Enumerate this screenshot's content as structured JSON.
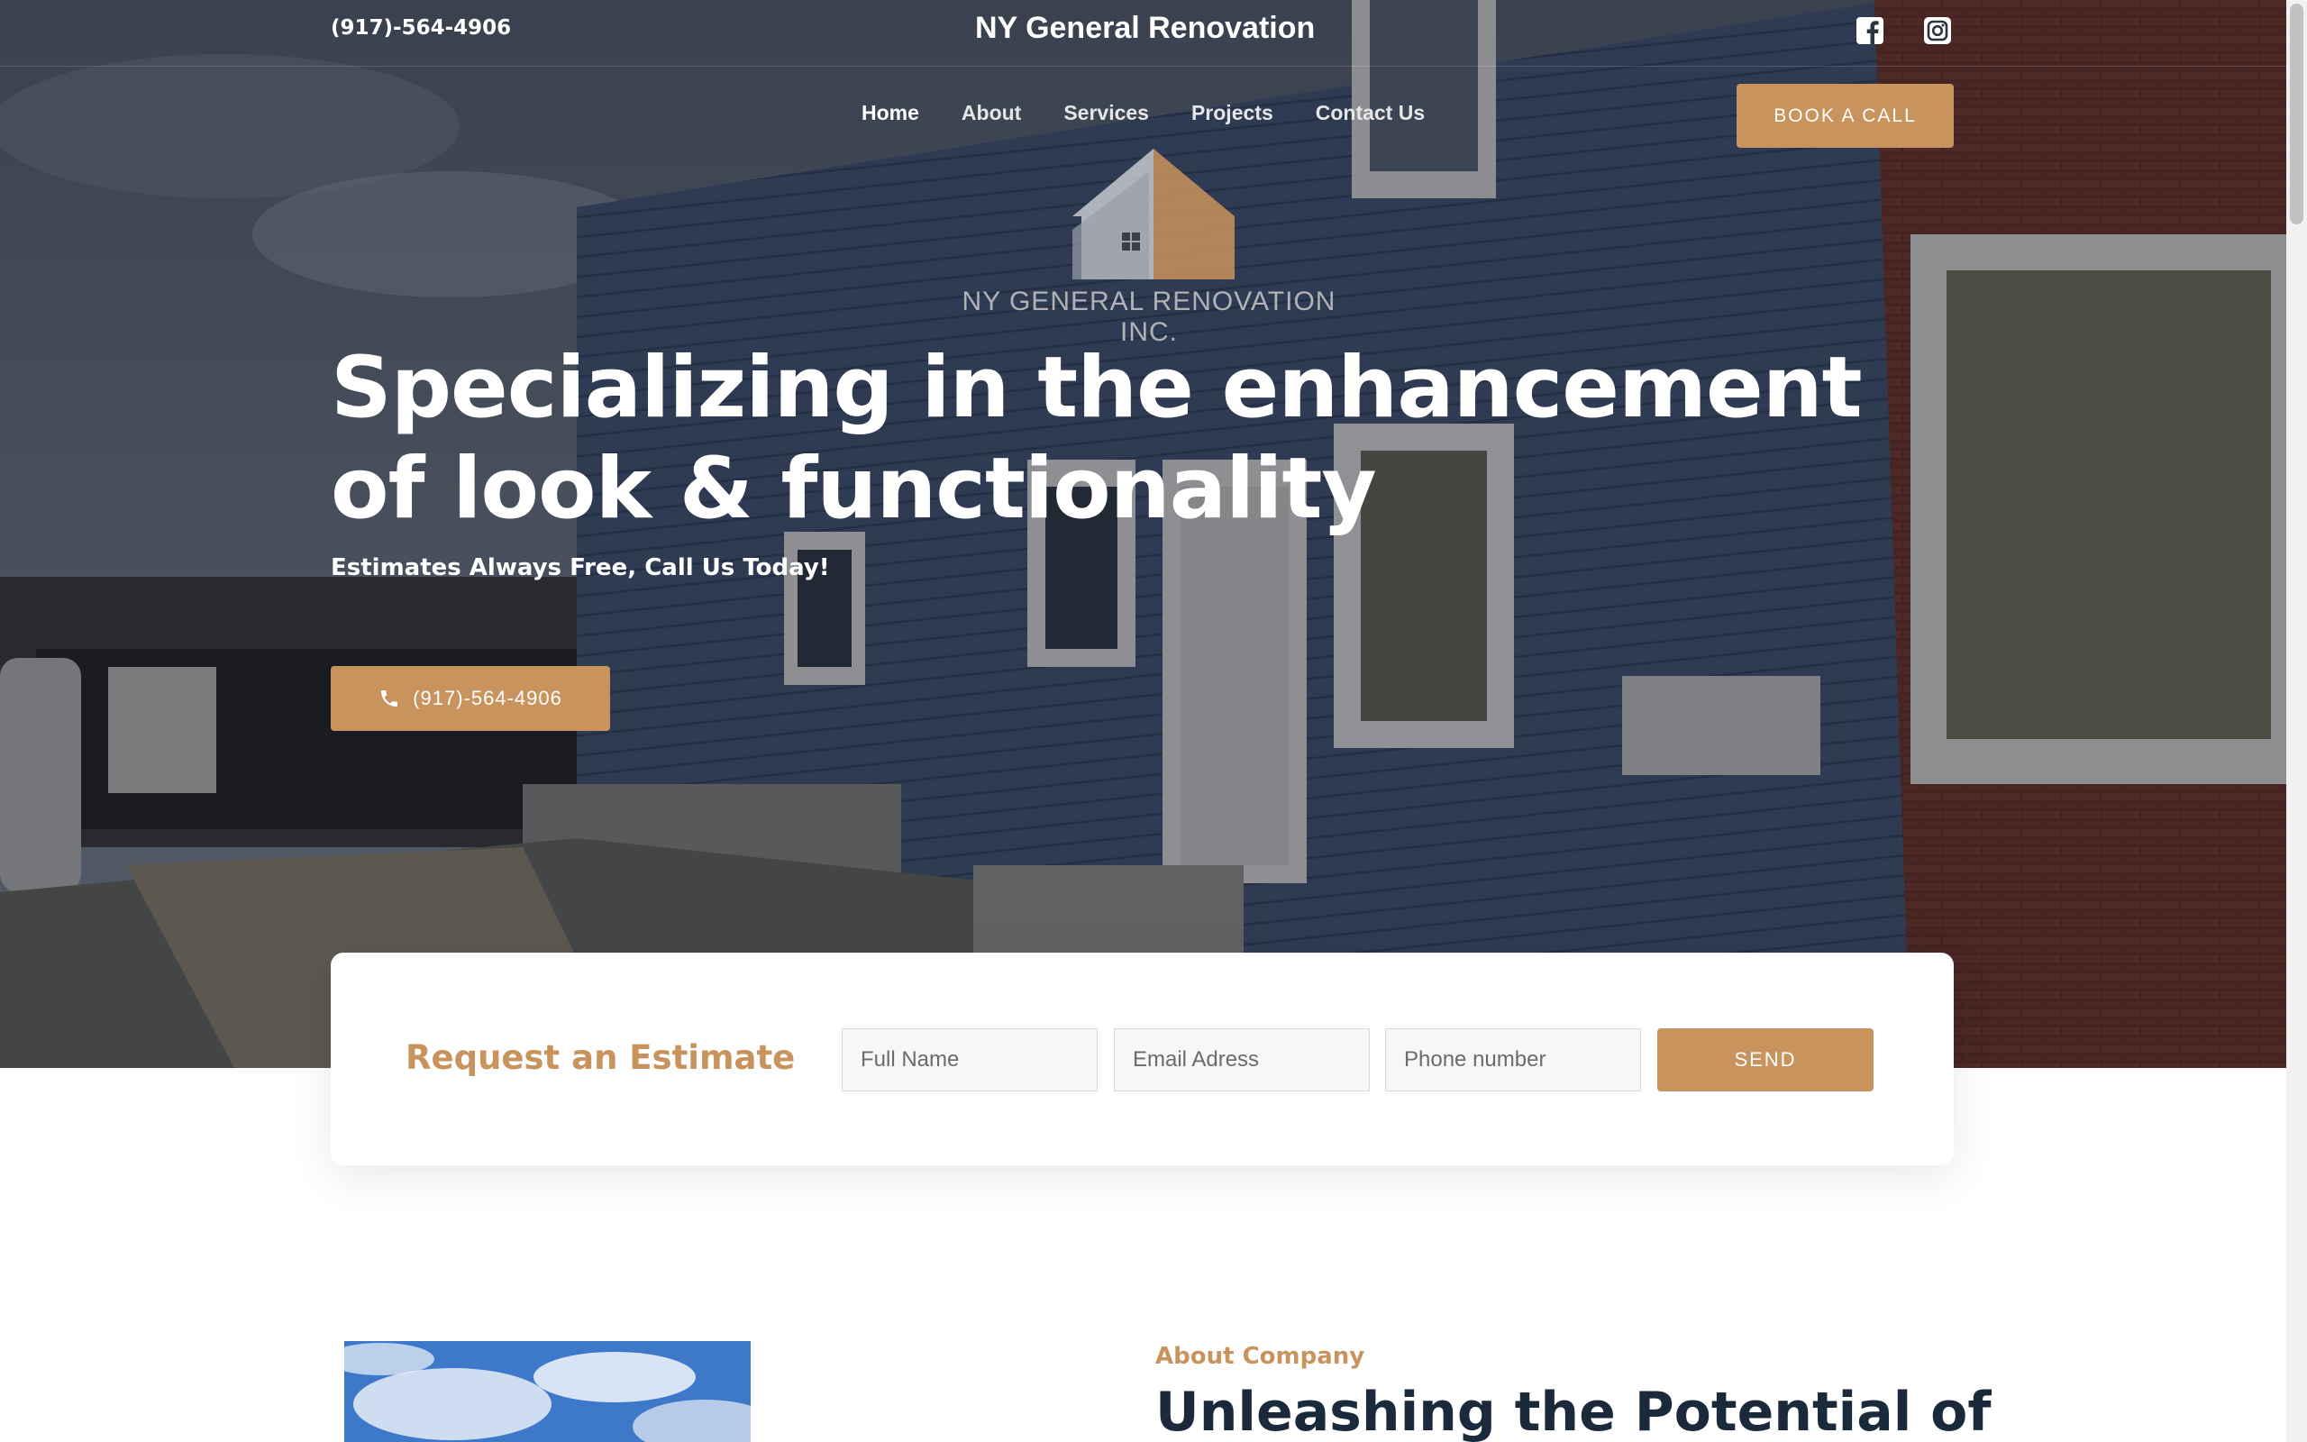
{
  "header": {
    "phone": "(917)-564-4906",
    "site_title": "NY General Renovation",
    "social": [
      {
        "name": "facebook-icon"
      },
      {
        "name": "instagram-icon"
      }
    ]
  },
  "nav": {
    "items": [
      {
        "label": "Home",
        "active": true
      },
      {
        "label": "About",
        "active": false
      },
      {
        "label": "Services",
        "active": false
      },
      {
        "label": "Projects",
        "active": false
      },
      {
        "label": "Contact Us",
        "active": false
      }
    ],
    "cta_label": "BOOK A CALL"
  },
  "logo": {
    "text": "NY GENERAL RENOVATION INC."
  },
  "hero": {
    "headline": "Specializing in the enhancement of look & functionality",
    "subhead": "Estimates Always Free, Call Us Today!",
    "call_label": "(917)-564-4906"
  },
  "estimate": {
    "title": "Request an Estimate",
    "fields": {
      "name_placeholder": "Full Name",
      "email_placeholder": "Email Adress",
      "phone_placeholder": "Phone number"
    },
    "send_label": "SEND"
  },
  "about": {
    "kicker": "About Company",
    "heading": "Unleashing the Potential of"
  },
  "colors": {
    "accent": "#c9935d",
    "heading_dark": "#1b2a3b"
  }
}
